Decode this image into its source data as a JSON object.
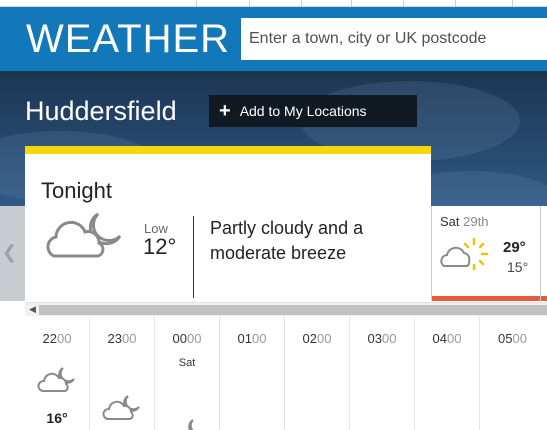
{
  "header": {
    "logo": "WEATHER",
    "search_placeholder": "Enter a town, city or UK postcode"
  },
  "location": {
    "name": "Huddersfield",
    "add_button_label": "Add to My Locations"
  },
  "tonight": {
    "title": "Tonight",
    "icon": "partly-cloudy-night-icon",
    "low_label": "Low",
    "low_temp": "12°",
    "description": "Partly cloudy and a moderate breeze"
  },
  "next_day": {
    "day": "Sat",
    "date": "29th",
    "icon": "sunny-intervals-icon",
    "high": "29°",
    "low": "15°"
  },
  "hourly": [
    {
      "hour": "22",
      "mins": "00",
      "day": "",
      "icon": "partly-cloudy-night-icon",
      "temp": "16°"
    },
    {
      "hour": "23",
      "mins": "00",
      "day": "",
      "icon": "partly-cloudy-night-icon",
      "temp": ""
    },
    {
      "hour": "00",
      "mins": "00",
      "day": "Sat",
      "icon": "partly-cloudy-night-icon",
      "temp": ""
    },
    {
      "hour": "01",
      "mins": "00",
      "day": "",
      "icon": "",
      "temp": ""
    },
    {
      "hour": "02",
      "mins": "00",
      "day": "",
      "icon": "",
      "temp": ""
    },
    {
      "hour": "03",
      "mins": "00",
      "day": "",
      "icon": "",
      "temp": ""
    },
    {
      "hour": "04",
      "mins": "00",
      "day": "",
      "icon": "",
      "temp": ""
    },
    {
      "hour": "05",
      "mins": "00",
      "day": "",
      "icon": "",
      "temp": ""
    }
  ],
  "colors": {
    "header_blue": "#1378b9",
    "tonight_accent": "#f4d80a",
    "day_accent": "#e45a3b"
  }
}
